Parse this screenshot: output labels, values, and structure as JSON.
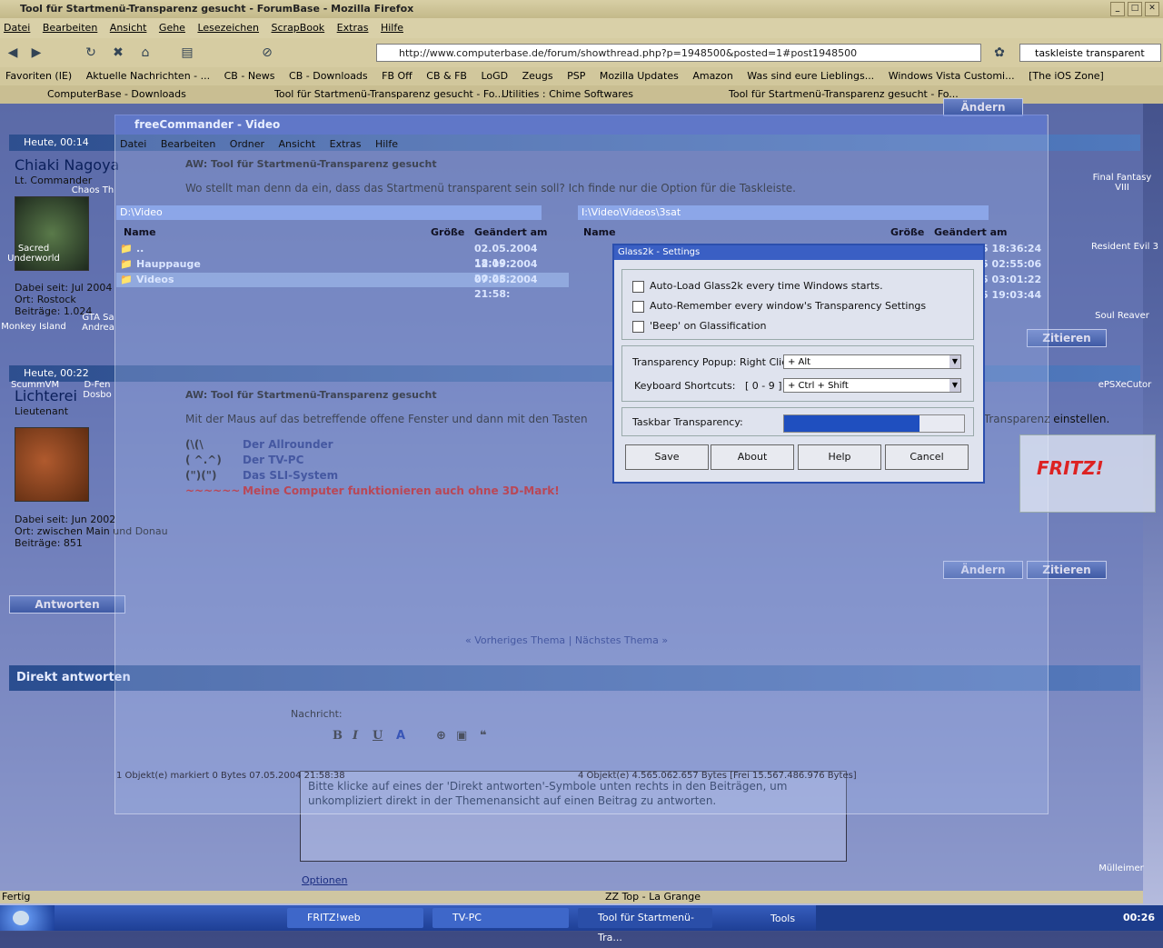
{
  "browser": {
    "title": "Tool für Startmenü-Transparenz gesucht - ForumBase - Mozilla Firefox",
    "menu": [
      "Datei",
      "Bearbeiten",
      "Ansicht",
      "Gehe",
      "Lesezeichen",
      "ScrapBook",
      "Extras",
      "Hilfe"
    ],
    "url": "http://www.computerbase.de/forum/showthread.php?p=1948500&posted=1#post1948500",
    "search": "taskleiste transparent",
    "bookmarks": [
      "Favoriten (IE)",
      "Aktuelle Nachrichten - ...",
      "CB - News",
      "CB - Downloads",
      "FB Off",
      "CB & FB",
      "LoGD",
      "Zeugs",
      "PSP",
      "Mozilla Updates",
      "Amazon",
      "Was sind eure Lieblings...",
      "Windows Vista Customi...",
      "[The iOS Zone]"
    ],
    "tabs": [
      "ComputerBase - Downloads",
      "Tool für Startmenü-Transparenz gesucht - Fo...",
      "Utilities : Chime Softwares",
      "Tool für Startmenü-Transparenz gesucht - Fo..."
    ],
    "status": "Fertig"
  },
  "posts": [
    {
      "time": "Heute, 00:14",
      "user": "Chiaki Nagoya",
      "rank": "Lt. Commander",
      "joined": "Dabei seit: Jul 2004",
      "location": "Ort: Rostock",
      "posts": "Beiträge: 1.024",
      "title": "AW: Tool für Startmenü-Transparenz gesucht",
      "text": "Wo stellt man denn da ein, dass das Startmenü transparent sein soll? Ich finde nur die Option für die Taskleiste."
    },
    {
      "time": "Heute, 00:22",
      "user": "Lichterei",
      "rank": "Lieutenant",
      "joined": "Dabei seit: Jun 2002",
      "location": "Ort: zwischen Main und Donau",
      "posts": "Beiträge: 851",
      "title": "AW: Tool für Startmenü-Transparenz gesucht",
      "text": "Mit der Maus auf das betreffende offene Fenster und dann mit den Tasten",
      "text_tail": "r Transparenz einstellen.",
      "sig": [
        {
          "art": "(\\(\\",
          "label": "Der Allrounder"
        },
        {
          "art": "( ^.^)",
          "label": "Der TV-PC"
        },
        {
          "art": "(\")(\")",
          "label": "Das SLI-System"
        },
        {
          "art": "~~~~~~",
          "label": "Meine Computer funktionieren auch ohne 3D-Mark!"
        }
      ]
    }
  ],
  "forum": {
    "edit": "Ändern",
    "quote": "Zitieren",
    "reply": "Antworten",
    "prev": "Vorheriges Thema",
    "next": "Nächstes Thema",
    "sep": "|",
    "direct_reply": "Direkt antworten",
    "message_label": "Nachricht:",
    "reply_hint": "Bitte klicke auf eines der 'Direkt antworten'-Symbole unten rechts in den Beiträgen, um unkompliziert direkt in der Themenansicht auf einen Beitrag zu antworten.",
    "options": "Optionen"
  },
  "freecommander": {
    "title": "freeCommander - Video",
    "menu": [
      "Datei",
      "Bearbeiten",
      "Ordner",
      "Ansicht",
      "Extras",
      "Hilfe"
    ],
    "left_path": "D:\\Video",
    "right_path": "I:\\Video\\Videos\\3sat",
    "col_name": "Name",
    "col_size": "Größe",
    "col_date": "Geändert am",
    "left_rows": [
      {
        "name": "..",
        "date": "02.05.2004 18:19:"
      },
      {
        "name": "Hauppauge",
        "date": "12.09.2004 20:28:"
      },
      {
        "name": "Videos",
        "date": "07.05.2004 21:58:"
      }
    ],
    "right_dates": [
      "5 18:36:24",
      "5 02:55:06",
      "5 03:01:22",
      "5 19:03:44"
    ],
    "status_left": "1 Objekt(e) markiert   0 Bytes  07.05.2004 21:58:38",
    "status_right": "4 Objekt(e)   4.565.062.657 Bytes   [Frei 15.567.486.976 Bytes]"
  },
  "glass2k": {
    "title": "Glass2k - Settings",
    "checks": [
      "Auto-Load Glass2k every time Windows starts.",
      "Auto-Remember every window's Transparency Settings",
      "'Beep' on Glassification"
    ],
    "popup_label": "Transparency Popup:  Right Click:",
    "popup_value": "+ Alt",
    "shortcut_label": "Keyboard Shortcuts:",
    "shortcut_keys": "[ 0 - 9 ] :",
    "shortcut_value": "+ Ctrl + Shift",
    "taskbar_label": "Taskbar Transparency:",
    "taskbar_level": 0.75,
    "buttons": [
      "Save",
      "About",
      "Help",
      "Cancel"
    ]
  },
  "desktop_icons": [
    "Final Fantasy VIII",
    "Resident Evil 3",
    "Soul Reaver",
    "ePSXeCutor",
    "Mülleimer",
    "Sacred Underworld",
    "Monkey Island",
    "Chaos Th",
    "GTA Sa Andrea",
    "ScummVM",
    "D-Fen Dosbo"
  ],
  "taskbar": {
    "start": "Start",
    "tasks": [
      "FRITZ!web",
      "TV-PC",
      "Tool für Startmenü-Tra..."
    ],
    "tools": "Tools",
    "clock": "00:26",
    "media": "ZZ Top - La Grange"
  },
  "colors": {
    "accent": "#2b4fae",
    "page": "#6e7dbe",
    "taskbar": "#1e3f95"
  }
}
